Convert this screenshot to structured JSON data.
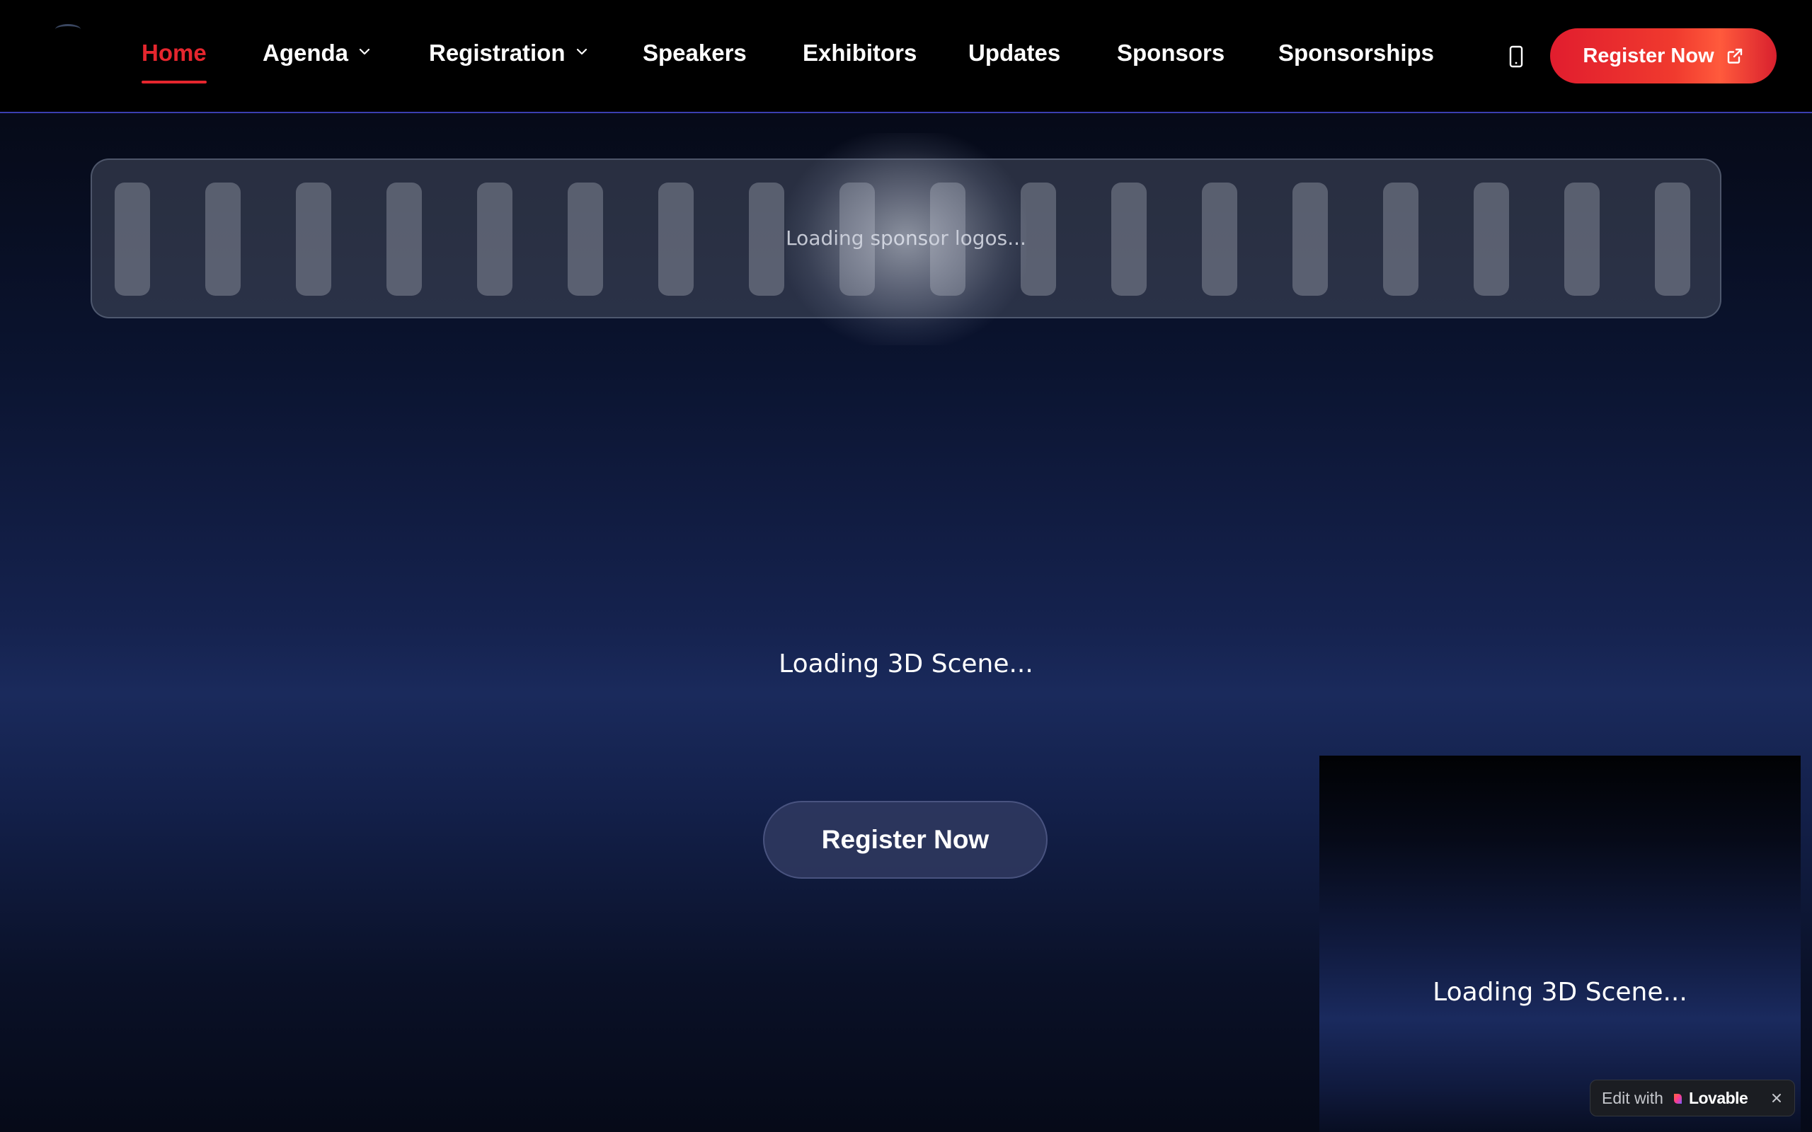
{
  "nav": {
    "items": [
      {
        "label": "Home",
        "active": true
      },
      {
        "label": "Agenda",
        "dropdown": true
      },
      {
        "label": "Registration",
        "dropdown": true
      },
      {
        "label": "Speakers"
      },
      {
        "label": "Exhibitors"
      },
      {
        "label": "Updates"
      },
      {
        "label": "Sponsors"
      },
      {
        "label": "Sponsorships"
      }
    ],
    "cta_label": "Register Now",
    "cta_icon": "external-link-icon",
    "phone_icon": "mobile-phone-icon"
  },
  "sponsors": {
    "loading_text": "Loading sponsor logos..."
  },
  "hero": {
    "scene_loading": "Loading 3D Scene...",
    "register_label": "Register Now"
  },
  "preview": {
    "scene_loading": "Loading 3D Scene..."
  },
  "badge": {
    "prefix": "Edit with",
    "brand": "Lovable"
  },
  "colors": {
    "accent": "#e5262e",
    "nav_background": "#000000",
    "nav_border": "#3b3fb0",
    "page_mid": "#1a2a5c"
  }
}
